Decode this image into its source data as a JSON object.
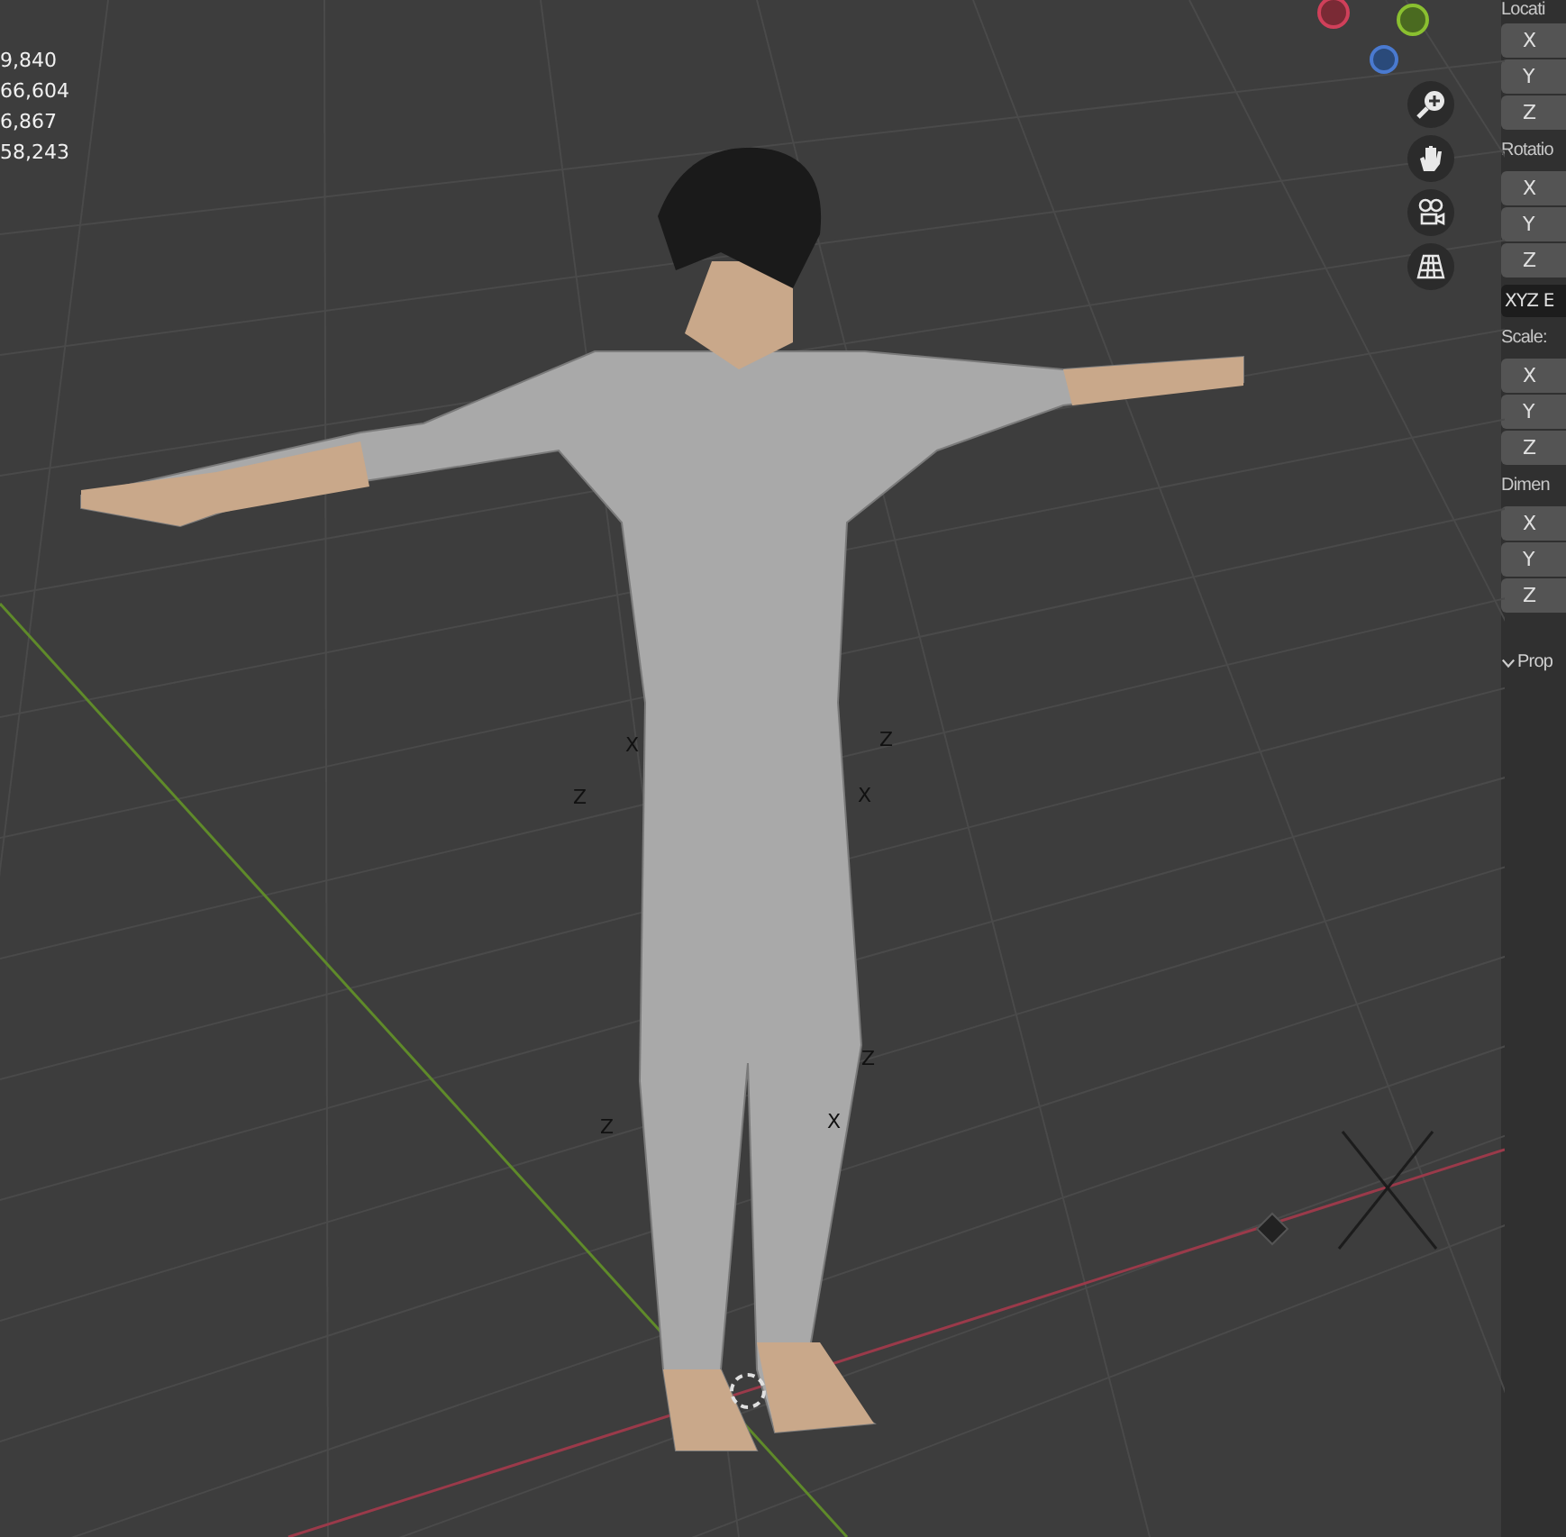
{
  "viewport": {
    "stats": [
      "9,840",
      "66,604",
      "6,867",
      "58,243"
    ],
    "empty_labels": [
      "Z",
      "X",
      "Z",
      "X",
      "Z",
      "Z",
      "X"
    ]
  },
  "panel": {
    "groups": [
      {
        "label": "Locati",
        "fields": [
          "X",
          "Y",
          "Z"
        ]
      },
      {
        "label": "Rotatio",
        "fields": [
          "X",
          "Y",
          "Z"
        ],
        "mode": "XYZ E"
      },
      {
        "label": "Scale:",
        "fields": [
          "X",
          "Y",
          "Z"
        ]
      },
      {
        "label": "Dimen",
        "fields": [
          "X",
          "Y",
          "Z"
        ]
      }
    ],
    "section": {
      "label": "Prop",
      "expanded": true
    }
  }
}
